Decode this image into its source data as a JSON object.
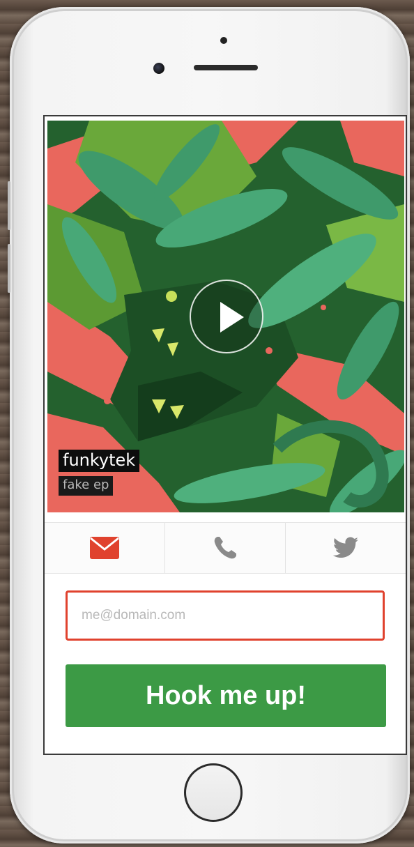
{
  "player": {
    "artist": "funkytek",
    "release": "fake ep"
  },
  "contact_tabs": [
    {
      "id": "email",
      "icon": "envelope-icon",
      "active": true
    },
    {
      "id": "phone",
      "icon": "phone-icon",
      "active": false
    },
    {
      "id": "twitter",
      "icon": "twitter-bird-icon",
      "active": false
    }
  ],
  "form": {
    "email_placeholder": "me@domain.com",
    "email_value": "",
    "submit_label": "Hook me up!"
  },
  "colors": {
    "accent_red": "#e0422e",
    "button_green": "#3c9a45",
    "inactive_icon": "#8a8a8a"
  }
}
